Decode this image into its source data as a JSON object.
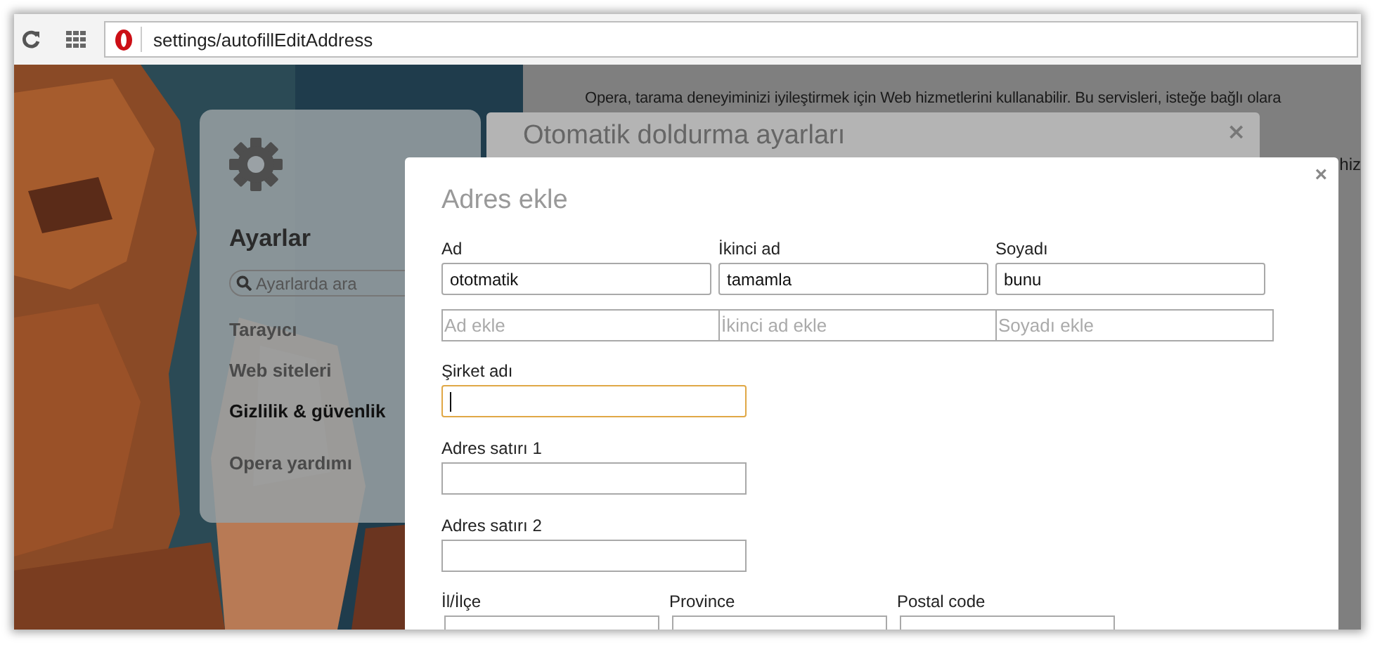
{
  "address_bar": {
    "url": "settings/autofillEditAddress"
  },
  "background_page": {
    "notice": "Opera, tarama deneyiminizi iyileştirmek için Web hizmetlerini kullanabilir. Bu servisleri, isteğe bağlı olara",
    "fragment": "hiz"
  },
  "sidebar": {
    "title": "Ayarlar",
    "search": {
      "placeholder": "Ayarlarda ara"
    },
    "items": [
      {
        "label": "Tarayıcı",
        "selected": false
      },
      {
        "label": "Web siteleri",
        "selected": false
      },
      {
        "label": "Gizlilik & güvenlik",
        "selected": true
      },
      {
        "label": "Opera yardımı",
        "selected": false
      }
    ]
  },
  "back_dialog": {
    "title": "Otomatik doldurma ayarları",
    "close": "×"
  },
  "dialog": {
    "title": "Adres ekle",
    "close": "×",
    "name_fields": [
      {
        "label": "Ad",
        "value": "ototmatik",
        "add_placeholder": "Ad ekle"
      },
      {
        "label": "İkinci ad",
        "value": "tamamla",
        "add_placeholder": "İkinci ad ekle"
      },
      {
        "label": "Soyadı",
        "value": "bunu",
        "add_placeholder": "Soyadı ekle"
      }
    ],
    "single_fields": [
      {
        "label": "Şirket adı",
        "focused": true
      },
      {
        "label": "Adres satırı 1",
        "focused": false
      },
      {
        "label": "Adres satırı 2",
        "focused": false
      }
    ],
    "region_fields": [
      {
        "label": "İl/İlçe"
      },
      {
        "label": "Province"
      },
      {
        "label": "Postal code"
      }
    ]
  }
}
